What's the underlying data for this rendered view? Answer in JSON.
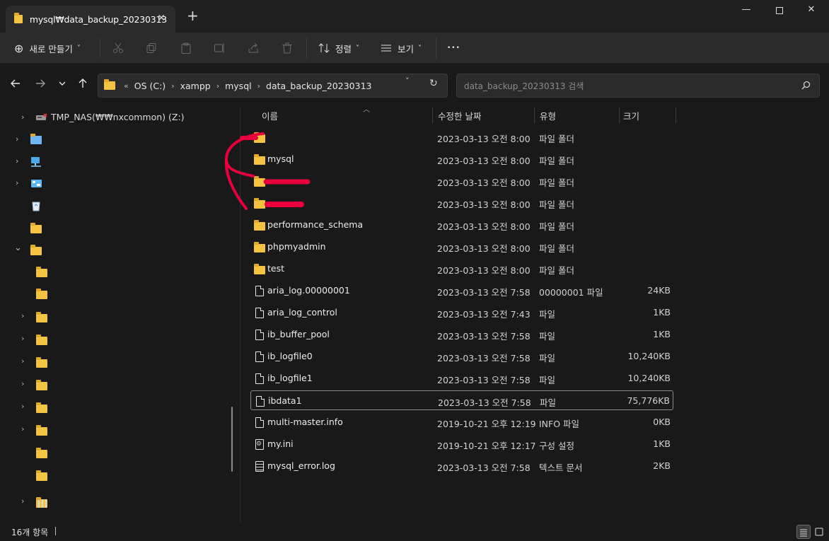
{
  "window": {
    "tab_title": "mysql₩data_backup_20230313",
    "tab_close": "✕",
    "new_tab": "+",
    "minimize": "—",
    "close": "✕"
  },
  "toolbar": {
    "new_label": "새로 만들기",
    "new_icon": "⊕",
    "sort_label": "정렬",
    "view_label": "보기",
    "more": "•••",
    "chevron": "˅"
  },
  "address": {
    "overflow": "«",
    "crumbs": [
      "OS (C:)",
      "xampp",
      "mysql",
      "data_backup_20230313"
    ],
    "separator": "›",
    "dropdown": "˅",
    "refresh": "↻"
  },
  "search": {
    "placeholder": "data_backup_20230313 검색",
    "icon": "⌕"
  },
  "sidebar": {
    "items": [
      {
        "label": "TMP_NAS(₩₩nxcommon) (Z:)",
        "icon": "network-drive-icon"
      },
      {
        "label": "",
        "icon": "folder-icon"
      },
      {
        "label": "",
        "icon": "network-icon"
      },
      {
        "label": "",
        "icon": "control-panel-icon"
      },
      {
        "label": "",
        "icon": "recycle-bin-icon"
      },
      {
        "label": "",
        "icon": "folder-icon"
      },
      {
        "label": "",
        "icon": "folder-icon"
      },
      {
        "label": "",
        "icon": "folder-icon"
      },
      {
        "label": "",
        "icon": "folder-icon"
      },
      {
        "label": "",
        "icon": "folder-icon"
      },
      {
        "label": "",
        "icon": "folder-icon"
      },
      {
        "label": "",
        "icon": "folder-icon"
      },
      {
        "label": "",
        "icon": "folder-icon"
      },
      {
        "label": "",
        "icon": "folder-icon"
      },
      {
        "label": "",
        "icon": "folder-icon"
      },
      {
        "label": "",
        "icon": "folder-icon"
      },
      {
        "label": "",
        "icon": "folder-icon"
      },
      {
        "label": "",
        "icon": "folder-icon"
      },
      {
        "label": "",
        "icon": "zip-folder-icon"
      }
    ]
  },
  "columns": {
    "name": "이름",
    "date": "수정한 날짜",
    "type": "유형",
    "size": "크기"
  },
  "files": [
    {
      "name": "",
      "date": "2023-03-13 오전 8:00",
      "type": "파일 폴더",
      "size": "",
      "icon": "folder-icon"
    },
    {
      "name": "mysql",
      "date": "2023-03-13 오전 8:00",
      "type": "파일 폴더",
      "size": "",
      "icon": "folder-icon"
    },
    {
      "name": "",
      "date": "2023-03-13 오전 8:00",
      "type": "파일 폴더",
      "size": "",
      "icon": "folder-icon"
    },
    {
      "name": "",
      "date": "2023-03-13 오전 8:00",
      "type": "파일 폴더",
      "size": "",
      "icon": "folder-icon"
    },
    {
      "name": "performance_schema",
      "date": "2023-03-13 오전 8:00",
      "type": "파일 폴더",
      "size": "",
      "icon": "folder-icon"
    },
    {
      "name": "phpmyadmin",
      "date": "2023-03-13 오전 8:00",
      "type": "파일 폴더",
      "size": "",
      "icon": "folder-icon"
    },
    {
      "name": "test",
      "date": "2023-03-13 오전 8:00",
      "type": "파일 폴더",
      "size": "",
      "icon": "folder-icon"
    },
    {
      "name": "aria_log.00000001",
      "date": "2023-03-13 오전 7:58",
      "type": "00000001 파일",
      "size": "24KB",
      "icon": "file-icon"
    },
    {
      "name": "aria_log_control",
      "date": "2023-03-13 오전 7:43",
      "type": "파일",
      "size": "1KB",
      "icon": "file-icon"
    },
    {
      "name": "ib_buffer_pool",
      "date": "2023-03-13 오전 7:58",
      "type": "파일",
      "size": "1KB",
      "icon": "file-icon"
    },
    {
      "name": "ib_logfile0",
      "date": "2023-03-13 오전 7:58",
      "type": "파일",
      "size": "10,240KB",
      "icon": "file-icon"
    },
    {
      "name": "ib_logfile1",
      "date": "2023-03-13 오전 7:58",
      "type": "파일",
      "size": "10,240KB",
      "icon": "file-icon"
    },
    {
      "name": "ibdata1",
      "date": "2023-03-13 오전 7:58",
      "type": "파일",
      "size": "75,776KB",
      "icon": "file-icon"
    },
    {
      "name": "multi-master.info",
      "date": "2019-10-21 오후 12:19",
      "type": "INFO 파일",
      "size": "0KB",
      "icon": "file-icon"
    },
    {
      "name": "my.ini",
      "date": "2019-10-21 오후 12:17",
      "type": "구성 설정",
      "size": "1KB",
      "icon": "settings-file-icon"
    },
    {
      "name": "mysql_error.log",
      "date": "2023-03-13 오전 7:58",
      "type": "텍스트 문서",
      "size": "2KB",
      "icon": "text-file-icon"
    }
  ],
  "selected_index": 12,
  "status": {
    "count": "16개 항목"
  },
  "colors": {
    "background": "#191919",
    "toolbar": "#2b2b2b",
    "folder": "#f4c33f",
    "annotation": "#e8003d"
  }
}
